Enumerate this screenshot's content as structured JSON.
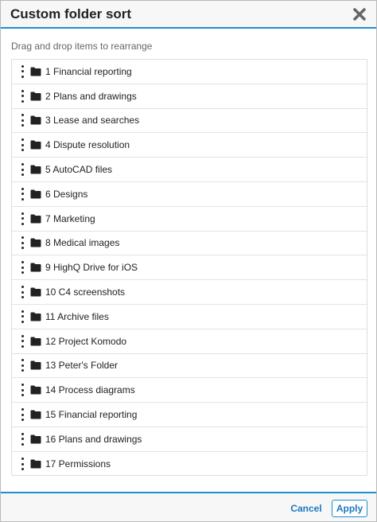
{
  "dialog": {
    "title": "Custom folder sort",
    "close_icon": "close-x-icon",
    "instructions": "Drag and drop items to rearrange"
  },
  "folders": [
    {
      "label": "1 Financial reporting"
    },
    {
      "label": "2 Plans and drawings"
    },
    {
      "label": "3 Lease and searches"
    },
    {
      "label": "4 Dispute resolution"
    },
    {
      "label": "5 AutoCAD files"
    },
    {
      "label": "6 Designs"
    },
    {
      "label": "7 Marketing"
    },
    {
      "label": "8 Medical images"
    },
    {
      "label": "9 HighQ Drive for iOS"
    },
    {
      "label": "10 C4 screenshots"
    },
    {
      "label": "11 Archive files"
    },
    {
      "label": "12 Project Komodo"
    },
    {
      "label": "13 Peter's Folder"
    },
    {
      "label": "14 Process diagrams"
    },
    {
      "label": "15 Financial reporting"
    },
    {
      "label": "16 Plans and drawings"
    },
    {
      "label": "17 Permissions"
    }
  ],
  "footer": {
    "cancel_label": "Cancel",
    "apply_label": "Apply"
  },
  "colors": {
    "accent": "#1b8fd0",
    "link": "#1b79c0",
    "header_bg": "#f7f7f7"
  },
  "icons": {
    "drag": "drag-handle-icon",
    "folder": "folder-icon"
  }
}
